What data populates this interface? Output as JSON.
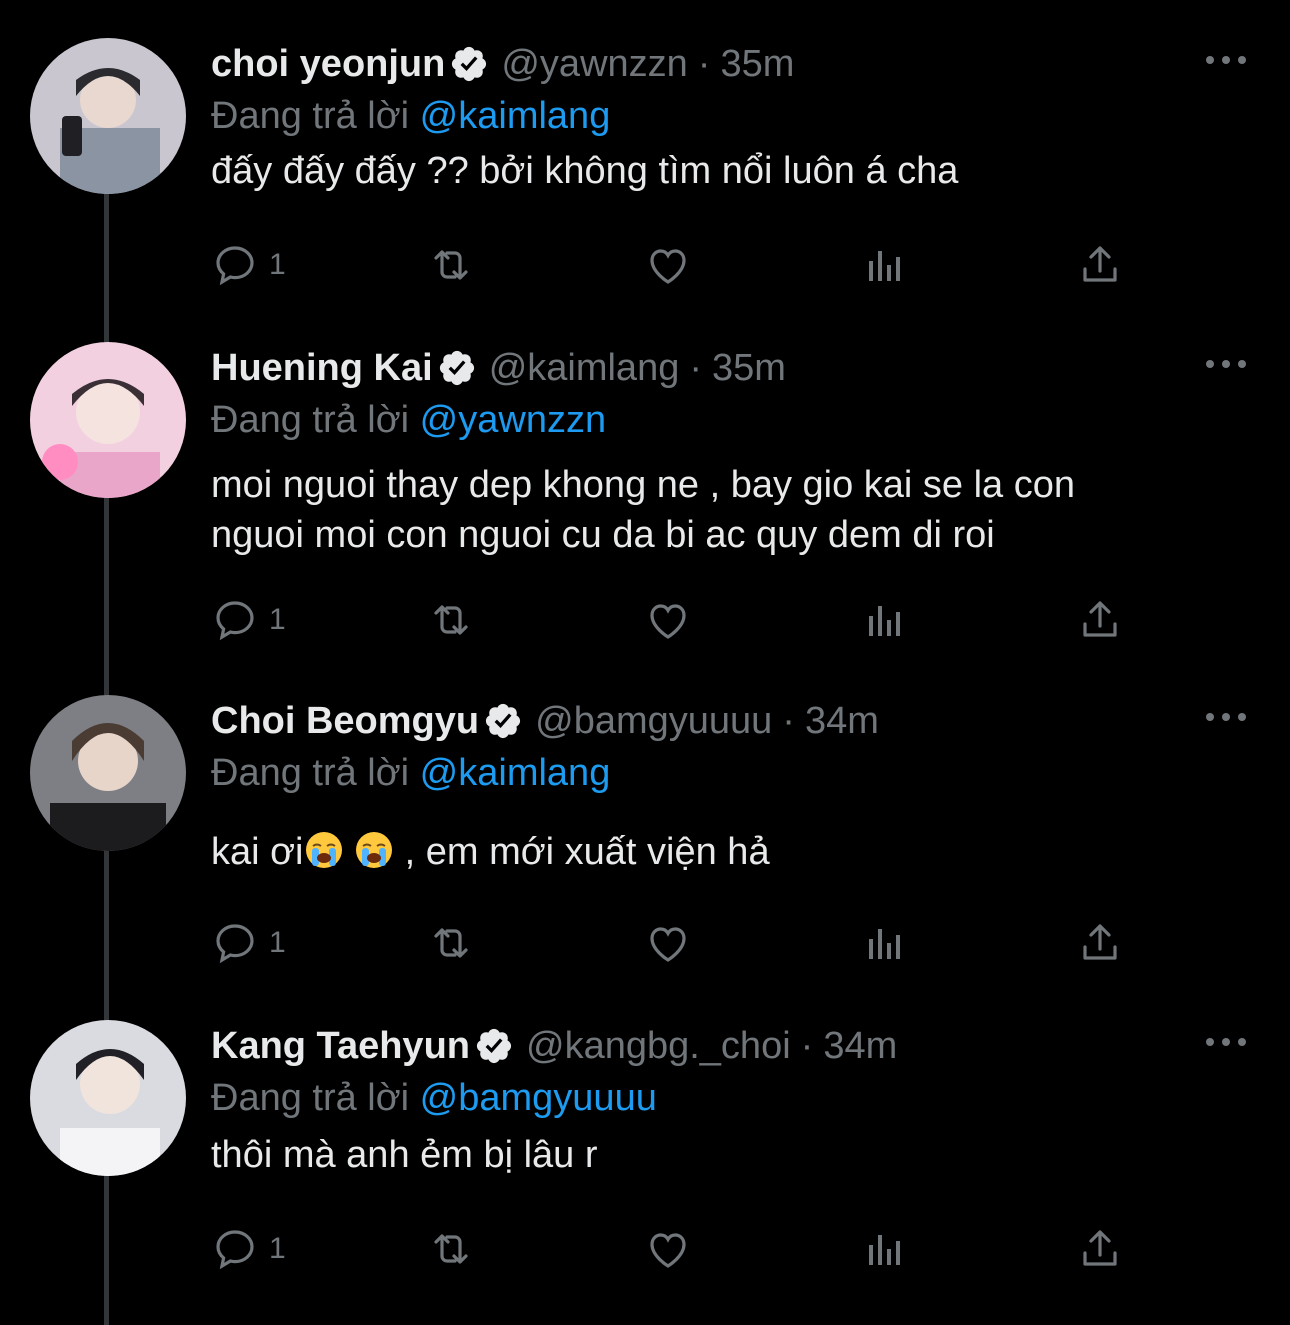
{
  "ui": {
    "accent": "#1d9bf0",
    "text_primary": "#e7e9ea",
    "text_secondary": "#71767b",
    "background": "#000000"
  },
  "tweets": [
    {
      "name": "choi yeonjun",
      "handle": "@yawnzzn",
      "dot": "·",
      "time": "35m",
      "replying_prefix": "Đang trả lời",
      "replying_to": "@kaimlang",
      "text_lines": [
        "đấy đấy đấy ?? bởi không tìm nổi luôn á cha"
      ],
      "reply_count": "1"
    },
    {
      "name": "Huening Kai",
      "handle": "@kaimlang",
      "dot": "·",
      "time": "35m",
      "replying_prefix": "Đang trả lời",
      "replying_to": "@yawnzzn",
      "text_lines": [
        "moi nguoi thay dep khong ne , bay gio kai se la con",
        "nguoi moi con nguoi cu da bi ac quy dem di roi"
      ],
      "reply_count": "1"
    },
    {
      "name": "Choi Beomgyu",
      "handle": "@bamgyuuuu",
      "dot": "·",
      "time": "34m",
      "replying_prefix": "Đang trả lời",
      "replying_to": "@kaimlang",
      "text_before_emoji": "kai ơi",
      "text_after_emoji": " , em mới xuất viện hả",
      "emoji_icons": [
        "loudly-crying-face-icon",
        "loudly-crying-face-icon"
      ],
      "reply_count": "1"
    },
    {
      "name": "Kang Taehyun",
      "handle": "@kangbg._choi",
      "dot": "·",
      "time": "34m",
      "replying_prefix": "Đang trả lời",
      "replying_to": "@bamgyuuuu",
      "text_lines": [
        "thôi mà anh ẻm bị lâu r"
      ],
      "reply_count": "1"
    }
  ]
}
